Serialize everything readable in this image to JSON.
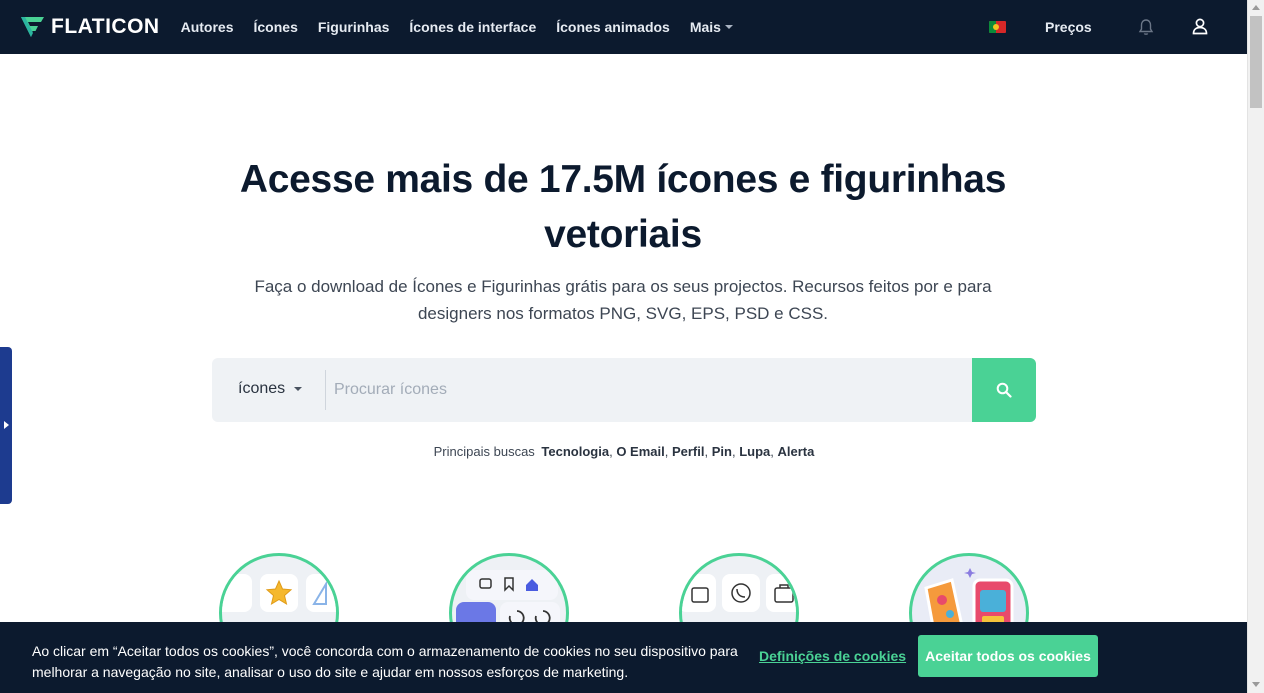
{
  "header": {
    "logo_text": "FLATICON",
    "nav": [
      {
        "label": "Autores"
      },
      {
        "label": "Ícones"
      },
      {
        "label": "Figurinhas"
      },
      {
        "label": "Ícones de interface"
      },
      {
        "label": "Ícones animados"
      },
      {
        "label": "Mais"
      }
    ],
    "pricing_label": "Preços",
    "language_flag": "portugal-flag-icon"
  },
  "hero": {
    "title": "Acesse mais de 17.5M ícones e figurinhas vetoriais",
    "subtitle": "Faça o download de Ícones e Figurinhas grátis para os seus projectos. Recursos feitos por e para designers nos formatos PNG, SVG, EPS, PSD e CSS."
  },
  "search": {
    "type_label": "ícones",
    "placeholder": "Procurar ícones",
    "value": "",
    "button_icon": "search-icon"
  },
  "top_searches": {
    "label": "Principais buscas",
    "terms": [
      "Tecnologia",
      "O Email",
      "Perfil",
      "Pin",
      "Lupa",
      "Alerta"
    ]
  },
  "cookie_banner": {
    "text": "Ao clicar em “Aceitar todos os cookies”, você concorda com o armazenamento de cookies no seu dispositivo para melhorar a navegação no site, analisar o uso do site e ajudar em nossos esforços de marketing.",
    "settings_label": "Definições de cookies",
    "accept_label": "Aceitar todos os cookies"
  },
  "colors": {
    "header_bg": "#0c1a2e",
    "accent": "#4ad295",
    "side_tab": "#1d3b8f"
  }
}
